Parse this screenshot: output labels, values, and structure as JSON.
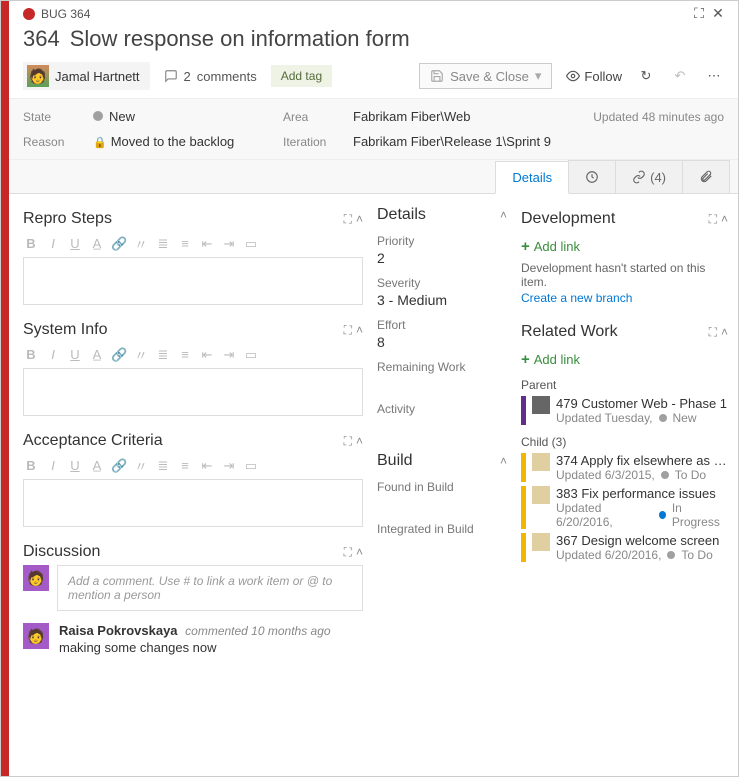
{
  "window": {
    "type_label": "BUG",
    "id": "364"
  },
  "header": {
    "id": "364",
    "title": "Slow response on information form"
  },
  "toolbar": {
    "assignee": "Jamal Hartnett",
    "comments_count": "2",
    "comments_label": "comments",
    "add_tag": "Add tag",
    "save_close": "Save & Close",
    "follow": "Follow"
  },
  "meta": {
    "state_label": "State",
    "state_value": "New",
    "area_label": "Area",
    "area_value": "Fabrikam Fiber\\Web",
    "reason_label": "Reason",
    "reason_value": "Moved to the backlog",
    "iteration_label": "Iteration",
    "iteration_value": "Fabrikam Fiber\\Release 1\\Sprint 9",
    "updated": "Updated 48 minutes ago"
  },
  "tabs": {
    "details": "Details",
    "links_count": "(4)"
  },
  "left": {
    "repro": "Repro Steps",
    "sysinfo": "System Info",
    "acceptance": "Acceptance Criteria",
    "discussion": "Discussion",
    "discussion_placeholder": "Add a comment. Use # to link a work item or @ to mention a person",
    "comment": {
      "author": "Raisa Pokrovskaya",
      "meta": "commented 10 months ago",
      "text": "making some changes now"
    }
  },
  "mid": {
    "details_head": "Details",
    "priority_label": "Priority",
    "priority_value": "2",
    "severity_label": "Severity",
    "severity_value": "3 - Medium",
    "effort_label": "Effort",
    "effort_value": "8",
    "remaining_label": "Remaining Work",
    "activity_label": "Activity",
    "build_head": "Build",
    "found_label": "Found in Build",
    "integrated_label": "Integrated in Build"
  },
  "right": {
    "dev_head": "Development",
    "add_link": "Add link",
    "dev_msg": "Development hasn't started on this item.",
    "dev_link": "Create a new branch",
    "rel_head": "Related Work",
    "parent_label": "Parent",
    "child_label": "Child (3)",
    "parent": {
      "id": "479",
      "title": "Customer Web - Phase 1",
      "sub": "Updated Tuesday,",
      "state": "New"
    },
    "children": [
      {
        "id": "374",
        "title": "Apply fix elsewhere as n…",
        "sub": "Updated 6/3/2015,",
        "state": "To Do",
        "dot": "grey"
      },
      {
        "id": "383",
        "title": "Fix performance issues",
        "sub": "Updated 6/20/2016,",
        "state": "In Progress",
        "dot": "blue"
      },
      {
        "id": "367",
        "title": "Design welcome screen",
        "sub": "Updated 6/20/2016,",
        "state": "To Do",
        "dot": "grey"
      }
    ]
  }
}
